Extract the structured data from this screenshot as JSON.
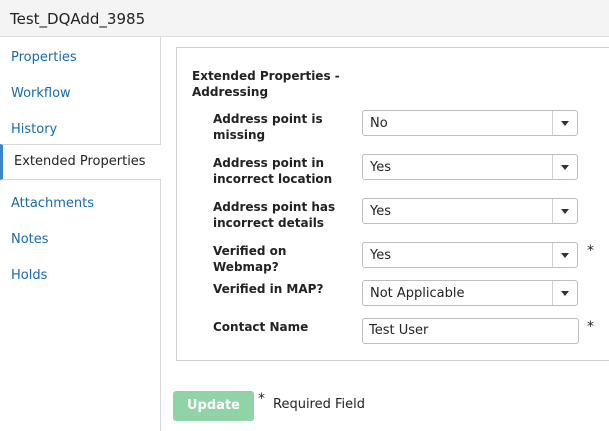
{
  "header": {
    "title": "Test_DQAdd_3985"
  },
  "sidebar": {
    "items": [
      {
        "label": "Properties"
      },
      {
        "label": "Workflow"
      },
      {
        "label": "History"
      },
      {
        "label": "Extended Properties"
      },
      {
        "label": "Attachments"
      },
      {
        "label": "Notes"
      },
      {
        "label": "Holds"
      }
    ],
    "active_index": 3
  },
  "form": {
    "section_title": "Extended Properties - Addressing",
    "fields": [
      {
        "label": "Address point is missing",
        "value": "No"
      },
      {
        "label": "Address point in incorrect location",
        "value": "Yes"
      },
      {
        "label": "Address point has incorrect details",
        "value": "Yes"
      },
      {
        "label": "Verified on Webmap?",
        "value": "Yes",
        "required": "*"
      },
      {
        "label": "Verified in MAP?",
        "value": "Not Applicable"
      },
      {
        "label": "Contact Name",
        "value": "Test User",
        "required": "*"
      }
    ]
  },
  "footer": {
    "update_label": "Update",
    "required_star": "*",
    "required_text": "Required Field"
  },
  "colors": {
    "link": "#1a6aa6",
    "active_border": "#3a86c8",
    "button": "#8fd3a6"
  }
}
